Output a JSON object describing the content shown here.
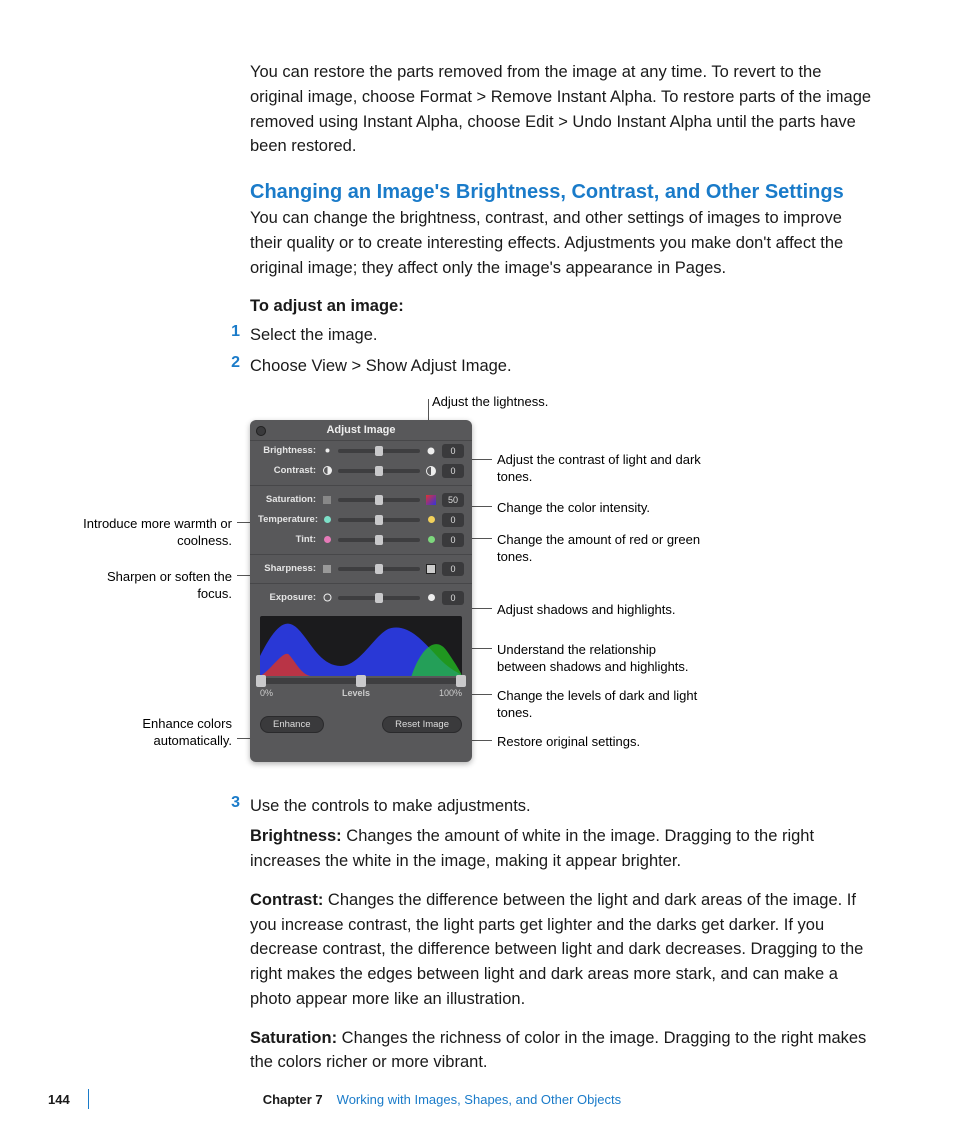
{
  "intro_para": "You can restore the parts removed from the image at any time. To revert to the original image, choose Format > Remove Instant Alpha. To restore parts of the image removed using Instant Alpha, choose Edit > Undo Instant Alpha until the parts have been restored.",
  "heading": "Changing an Image's Brightness, Contrast, and Other Settings",
  "heading_para": "You can change the brightness, contrast, and other settings of images to improve their quality or to create interesting effects. Adjustments you make don't affect the original image; they affect only the image's appearance in Pages.",
  "sub_heading": "To adjust an image:",
  "steps": {
    "s1": {
      "num": "1",
      "text": "Select the image."
    },
    "s2": {
      "num": "2",
      "text": "Choose View > Show Adjust Image."
    },
    "s3": {
      "num": "3",
      "text": "Use the controls to make adjustments."
    }
  },
  "panel": {
    "title": "Adjust Image",
    "brightness": {
      "label": "Brightness:",
      "value": "0"
    },
    "contrast": {
      "label": "Contrast:",
      "value": "0"
    },
    "saturation": {
      "label": "Saturation:",
      "value": "50"
    },
    "temperature": {
      "label": "Temperature:",
      "value": "0"
    },
    "tint": {
      "label": "Tint:",
      "value": "0"
    },
    "sharpness": {
      "label": "Sharpness:",
      "value": "0"
    },
    "exposure": {
      "label": "Exposure:",
      "value": "0"
    },
    "levels": {
      "label": "Levels",
      "left": "0%",
      "right": "100%"
    },
    "enhance_btn": "Enhance",
    "reset_btn": "Reset Image"
  },
  "callouts": {
    "lightness": "Adjust the lightness.",
    "contrast": "Adjust the contrast of light and dark tones.",
    "intensity": "Change the color intensity.",
    "warmth": "Introduce more warmth or coolness.",
    "redgreen": "Change the amount of red or green tones.",
    "sharpen": "Sharpen or soften the focus.",
    "shadows": "Adjust shadows and highlights.",
    "understand": "Understand the relationship between shadows and highlights.",
    "levels": "Change the levels of dark and light tones.",
    "enhance": "Enhance colors automatically.",
    "restore": "Restore original settings."
  },
  "definitions": {
    "brightness": {
      "term": "Brightness:",
      "text": "  Changes the amount of white in the image. Dragging to the right increases the white in the image, making it appear brighter."
    },
    "contrast": {
      "term": "Contrast:",
      "text": "  Changes the difference between the light and dark areas of the image. If you increase contrast, the light parts get lighter and the darks get darker. If you decrease contrast, the difference between light and dark decreases. Dragging to the right makes the edges between light and dark areas more stark, and can make a photo appear more like an illustration."
    },
    "saturation": {
      "term": "Saturation:",
      "text": "  Changes the richness of color in the image. Dragging to the right makes the colors richer or more vibrant."
    }
  },
  "footer": {
    "page": "144",
    "chapter_label": "Chapter 7",
    "chapter_title": "Working with Images, Shapes, and Other Objects"
  }
}
